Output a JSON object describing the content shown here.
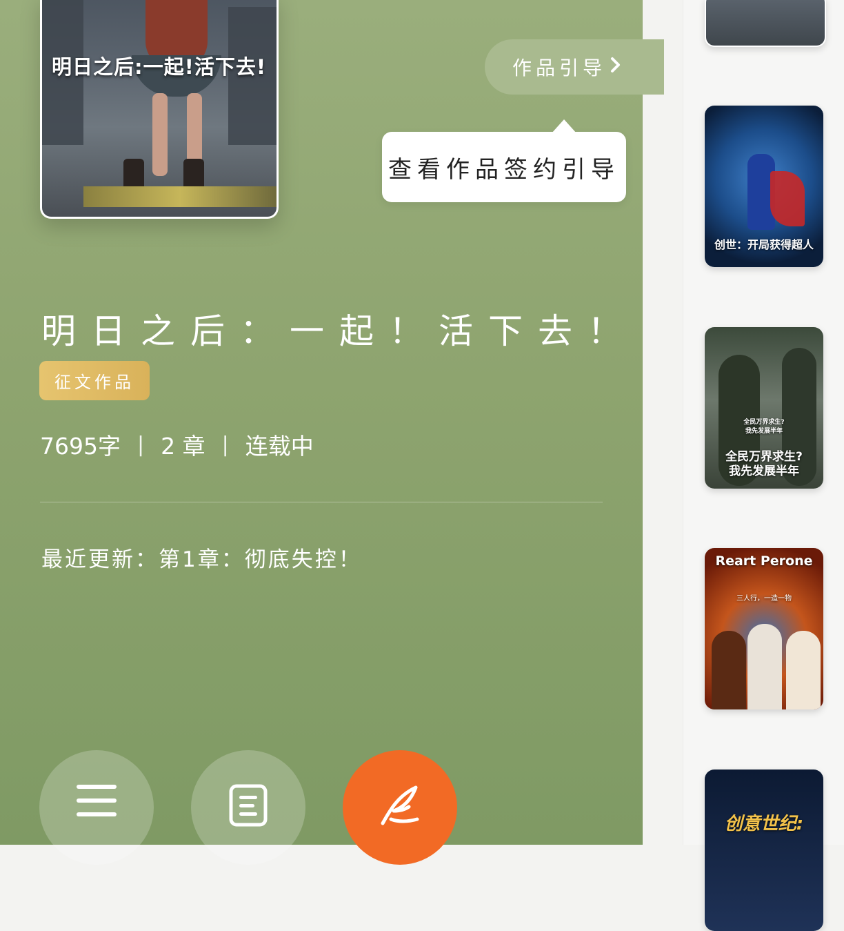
{
  "cover": {
    "title": "明日之后:一起!活下去!"
  },
  "guide": {
    "label": "作品引导"
  },
  "tooltip": {
    "text": "查看作品签约引导"
  },
  "book": {
    "title": "明日之后：一起！活下去！",
    "tag": "征文作品",
    "word_count": "7695字",
    "chapters": "2 章",
    "status": "连载中",
    "separator": "|",
    "latest_update": "最近更新：第1章：彻底失控！"
  },
  "actions": {
    "menu_icon": "menu-icon",
    "doc_icon": "document-icon",
    "write_icon": "quill-icon",
    "write_color": "#f26a25"
  },
  "rail": {
    "items": [
      {
        "caption": ""
      },
      {
        "caption": "创世：开局获得超人"
      },
      {
        "caption": "全民万界求生?\n我先发展半年",
        "small": "全民万界求生?\n我先发展半年"
      },
      {
        "caption": "Reart Perone",
        "sub": "三人行，一造一物"
      },
      {
        "caption": "创意世纪:"
      }
    ]
  }
}
